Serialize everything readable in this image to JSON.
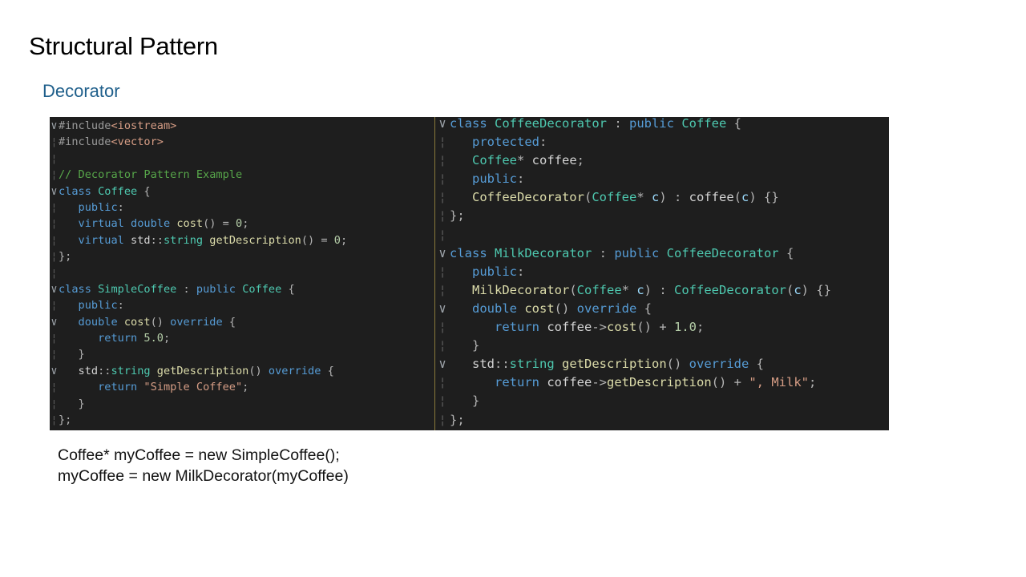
{
  "slide": {
    "title": "Structural Pattern",
    "subtitle": "Decorator"
  },
  "left_code": {
    "lines": [
      [
        {
          "t": "#include",
          "c": "pp"
        },
        {
          "t": "<iostream>",
          "c": "str"
        }
      ],
      [
        {
          "t": "#include",
          "c": "pp"
        },
        {
          "t": "<vector>",
          "c": "str"
        }
      ],
      [],
      [
        {
          "t": "// Decorator Pattern Example",
          "c": "com"
        }
      ],
      [
        {
          "t": "class ",
          "c": "kw"
        },
        {
          "t": "Coffee",
          "c": "ty"
        },
        {
          "t": " {",
          "c": "punc"
        }
      ],
      [
        {
          "t": "   public",
          "c": "kw"
        },
        {
          "t": ":",
          "c": "punc"
        }
      ],
      [
        {
          "t": "   virtual ",
          "c": "kw"
        },
        {
          "t": "double ",
          "c": "kw"
        },
        {
          "t": "cost",
          "c": "fn"
        },
        {
          "t": "() = ",
          "c": "punc"
        },
        {
          "t": "0",
          "c": "num"
        },
        {
          "t": ";",
          "c": "punc"
        }
      ],
      [
        {
          "t": "   virtual ",
          "c": "kw"
        },
        {
          "t": "std",
          "c": "id"
        },
        {
          "t": "::",
          "c": "punc"
        },
        {
          "t": "string ",
          "c": "ty"
        },
        {
          "t": "getDescription",
          "c": "fn"
        },
        {
          "t": "() = ",
          "c": "punc"
        },
        {
          "t": "0",
          "c": "num"
        },
        {
          "t": ";",
          "c": "punc"
        }
      ],
      [
        {
          "t": "};",
          "c": "punc"
        }
      ],
      [],
      [
        {
          "t": "class ",
          "c": "kw"
        },
        {
          "t": "SimpleCoffee",
          "c": "ty"
        },
        {
          "t": " : ",
          "c": "punc"
        },
        {
          "t": "public ",
          "c": "kw"
        },
        {
          "t": "Coffee",
          "c": "ty"
        },
        {
          "t": " {",
          "c": "punc"
        }
      ],
      [
        {
          "t": "   public",
          "c": "kw"
        },
        {
          "t": ":",
          "c": "punc"
        }
      ],
      [
        {
          "t": "   double ",
          "c": "kw"
        },
        {
          "t": "cost",
          "c": "fn"
        },
        {
          "t": "() ",
          "c": "punc"
        },
        {
          "t": "override",
          "c": "kw"
        },
        {
          "t": " {",
          "c": "punc"
        }
      ],
      [
        {
          "t": "      return ",
          "c": "kw"
        },
        {
          "t": "5.0",
          "c": "num"
        },
        {
          "t": ";",
          "c": "punc"
        }
      ],
      [
        {
          "t": "   }",
          "c": "punc"
        }
      ],
      [
        {
          "t": "   std",
          "c": "id"
        },
        {
          "t": "::",
          "c": "punc"
        },
        {
          "t": "string ",
          "c": "ty"
        },
        {
          "t": "getDescription",
          "c": "fn"
        },
        {
          "t": "() ",
          "c": "punc"
        },
        {
          "t": "override",
          "c": "kw"
        },
        {
          "t": " {",
          "c": "punc"
        }
      ],
      [
        {
          "t": "      return ",
          "c": "kw"
        },
        {
          "t": "\"Simple Coffee\"",
          "c": "str"
        },
        {
          "t": ";",
          "c": "punc"
        }
      ],
      [
        {
          "t": "   }",
          "c": "punc"
        }
      ],
      [
        {
          "t": "};",
          "c": "punc"
        }
      ]
    ],
    "fold_lines": [
      0,
      4,
      10,
      12,
      15
    ]
  },
  "right_code": {
    "lines": [
      [
        {
          "t": "class ",
          "c": "kw"
        },
        {
          "t": "CoffeeDecorator",
          "c": "ty"
        },
        {
          "t": " : ",
          "c": "punc"
        },
        {
          "t": "public ",
          "c": "kw"
        },
        {
          "t": "Coffee",
          "c": "ty"
        },
        {
          "t": " {",
          "c": "punc"
        }
      ],
      [
        {
          "t": "   protected",
          "c": "kw"
        },
        {
          "t": ":",
          "c": "punc"
        }
      ],
      [
        {
          "t": "   Coffee",
          "c": "ty"
        },
        {
          "t": "* ",
          "c": "punc"
        },
        {
          "t": "coffee",
          "c": "id"
        },
        {
          "t": ";",
          "c": "punc"
        }
      ],
      [
        {
          "t": "   public",
          "c": "kw"
        },
        {
          "t": ":",
          "c": "punc"
        }
      ],
      [
        {
          "t": "   CoffeeDecorator",
          "c": "fn"
        },
        {
          "t": "(",
          "c": "punc"
        },
        {
          "t": "Coffee",
          "c": "ty"
        },
        {
          "t": "* ",
          "c": "punc"
        },
        {
          "t": "c",
          "c": "par"
        },
        {
          "t": ") : ",
          "c": "punc"
        },
        {
          "t": "coffee",
          "c": "id"
        },
        {
          "t": "(",
          "c": "punc"
        },
        {
          "t": "c",
          "c": "par"
        },
        {
          "t": ") {}",
          "c": "punc"
        }
      ],
      [
        {
          "t": "};",
          "c": "punc"
        }
      ],
      [],
      [
        {
          "t": "class ",
          "c": "kw"
        },
        {
          "t": "MilkDecorator",
          "c": "ty"
        },
        {
          "t": " : ",
          "c": "punc"
        },
        {
          "t": "public ",
          "c": "kw"
        },
        {
          "t": "CoffeeDecorator",
          "c": "ty"
        },
        {
          "t": " {",
          "c": "punc"
        }
      ],
      [
        {
          "t": "   public",
          "c": "kw"
        },
        {
          "t": ":",
          "c": "punc"
        }
      ],
      [
        {
          "t": "   MilkDecorator",
          "c": "fn"
        },
        {
          "t": "(",
          "c": "punc"
        },
        {
          "t": "Coffee",
          "c": "ty"
        },
        {
          "t": "* ",
          "c": "punc"
        },
        {
          "t": "c",
          "c": "par"
        },
        {
          "t": ") : ",
          "c": "punc"
        },
        {
          "t": "CoffeeDecorator",
          "c": "ty"
        },
        {
          "t": "(",
          "c": "punc"
        },
        {
          "t": "c",
          "c": "par"
        },
        {
          "t": ") {}",
          "c": "punc"
        }
      ],
      [
        {
          "t": "   double ",
          "c": "kw"
        },
        {
          "t": "cost",
          "c": "fn"
        },
        {
          "t": "() ",
          "c": "punc"
        },
        {
          "t": "override",
          "c": "kw"
        },
        {
          "t": " {",
          "c": "punc"
        }
      ],
      [
        {
          "t": "      return ",
          "c": "kw"
        },
        {
          "t": "coffee",
          "c": "id"
        },
        {
          "t": "->",
          "c": "punc"
        },
        {
          "t": "cost",
          "c": "fn"
        },
        {
          "t": "() + ",
          "c": "punc"
        },
        {
          "t": "1.0",
          "c": "num"
        },
        {
          "t": ";",
          "c": "punc"
        }
      ],
      [
        {
          "t": "   }",
          "c": "punc"
        }
      ],
      [
        {
          "t": "   std",
          "c": "id"
        },
        {
          "t": "::",
          "c": "punc"
        },
        {
          "t": "string ",
          "c": "ty"
        },
        {
          "t": "getDescription",
          "c": "fn"
        },
        {
          "t": "() ",
          "c": "punc"
        },
        {
          "t": "override",
          "c": "kw"
        },
        {
          "t": " {",
          "c": "punc"
        }
      ],
      [
        {
          "t": "      return ",
          "c": "kw"
        },
        {
          "t": "coffee",
          "c": "id"
        },
        {
          "t": "->",
          "c": "punc"
        },
        {
          "t": "getDescription",
          "c": "fn"
        },
        {
          "t": "() + ",
          "c": "punc"
        },
        {
          "t": "\", Milk\"",
          "c": "str"
        },
        {
          "t": ";",
          "c": "punc"
        }
      ],
      [
        {
          "t": "   }",
          "c": "punc"
        }
      ],
      [
        {
          "t": "};",
          "c": "punc"
        }
      ]
    ],
    "fold_lines": [
      0,
      7,
      10,
      13
    ]
  },
  "snippet": {
    "line1": "Coffee* myCoffee = new SimpleCoffee();",
    "line2": "myCoffee = new MilkDecorator(myCoffee)"
  },
  "colors": {
    "editor_background": "#1e1e1e",
    "keyword": "#569cd6",
    "type": "#4ec9b0",
    "function": "#dcdcaa",
    "string": "#d69d85",
    "comment": "#57a64a",
    "subtitle": "#1f5f8b"
  },
  "icons": {
    "fold_marker": "chevron-down-icon"
  }
}
